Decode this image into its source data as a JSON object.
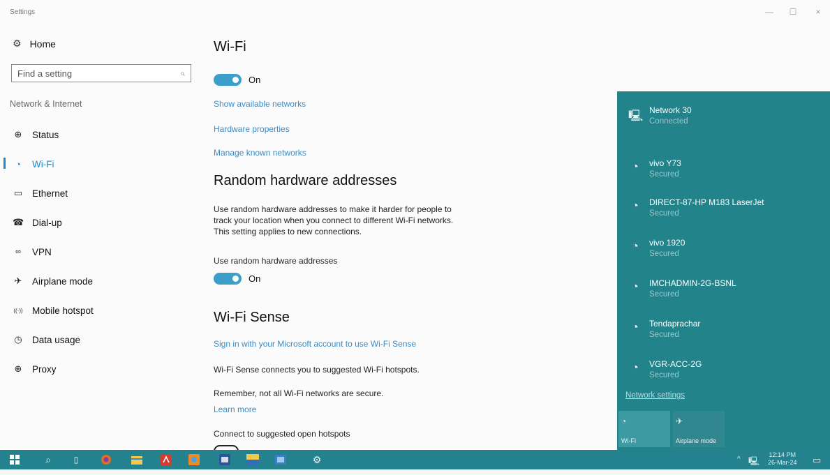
{
  "window": {
    "title": "Settings",
    "controls": {
      "minimize": "—",
      "maximize": "☐",
      "close": "×"
    }
  },
  "sidebar": {
    "home_label": "Home",
    "search_placeholder": "Find a setting",
    "section_title": "Network & Internet",
    "items": [
      {
        "label": "Status",
        "icon": "globe-icon",
        "glyph": "⊕"
      },
      {
        "label": "Wi-Fi",
        "icon": "wifi-icon",
        "glyph": "◔",
        "active": true
      },
      {
        "label": "Ethernet",
        "icon": "ethernet-icon",
        "glyph": "▭"
      },
      {
        "label": "Dial-up",
        "icon": "dialup-icon",
        "glyph": "☎"
      },
      {
        "label": "VPN",
        "icon": "vpn-icon",
        "glyph": "∞"
      },
      {
        "label": "Airplane mode",
        "icon": "airplane-icon",
        "glyph": "✈"
      },
      {
        "label": "Mobile hotspot",
        "icon": "hotspot-icon",
        "glyph": "((·))"
      },
      {
        "label": "Data usage",
        "icon": "data-usage-icon",
        "glyph": "◷"
      },
      {
        "label": "Proxy",
        "icon": "proxy-icon",
        "glyph": "⊕"
      }
    ]
  },
  "main": {
    "title": "Wi-Fi",
    "wifi_toggle_label": "On",
    "links": [
      "Show available networks",
      "Hardware properties",
      "Manage known networks"
    ],
    "random_hw": {
      "heading": "Random hardware addresses",
      "description_lines": [
        "Use random hardware addresses to make it harder for people to",
        "track your location when you connect to different Wi-Fi networks.",
        "This setting applies to new connections."
      ],
      "toggle_caption": "Use random hardware addresses",
      "toggle_label": "On"
    },
    "wifi_sense": {
      "heading": "Wi-Fi Sense",
      "signin_link": "Sign in with your Microsoft account to use Wi-Fi Sense",
      "description": "Wi-Fi Sense connects you to suggested Wi-Fi hotspots.",
      "remember": "Remember, not all Wi-Fi networks are secure.",
      "learn_more": "Learn more",
      "connect_caption": "Connect to suggested open hotspots"
    }
  },
  "flyout": {
    "networks": [
      {
        "name": "Network  30",
        "status": "Connected",
        "icon": "ethernet-network-icon"
      },
      {
        "name": "vivo Y73",
        "status": "Secured",
        "icon": "wifi-signal-icon"
      },
      {
        "name": "DIRECT-87-HP M183 LaserJet",
        "status": "Secured",
        "icon": "wifi-signal-icon"
      },
      {
        "name": "vivo 1920",
        "status": "Secured",
        "icon": "wifi-signal-icon"
      },
      {
        "name": "IMCHADMIN-2G-BSNL",
        "status": "Secured",
        "icon": "wifi-signal-icon"
      },
      {
        "name": "Tendaprachar",
        "status": "Secured",
        "icon": "wifi-signal-icon"
      },
      {
        "name": "VGR-ACC-2G",
        "status": "Secured",
        "icon": "wifi-signal-icon"
      }
    ],
    "settings_link": "Network settings",
    "quick_actions": [
      {
        "label": "Wi-Fi",
        "icon": "wifi-icon"
      },
      {
        "label": "Airplane mode",
        "icon": "airplane-icon"
      }
    ]
  },
  "taskbar": {
    "time": "12:14 PM",
    "date": "26-Mar-24"
  }
}
